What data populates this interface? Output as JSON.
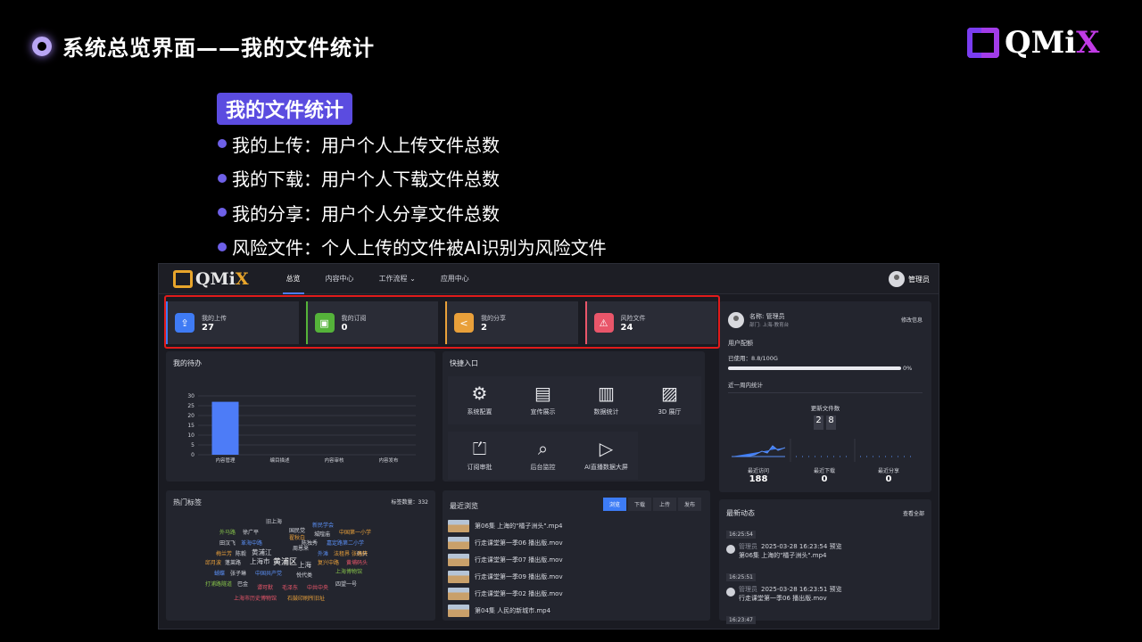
{
  "slide": {
    "title": "系统总览界面——我的文件统计",
    "logo": "QMi",
    "logo_x": "X",
    "section": "我的文件统计",
    "points": [
      "我的上传：用户个人上传文件总数",
      "我的下载：用户个人下载文件总数",
      "我的分享：用户个人分享文件总数",
      "风险文件：个人上传的文件被AI识别为风险文件"
    ]
  },
  "app": {
    "logo": "QMi",
    "logo_x": "X",
    "nav": [
      "总览",
      "内容中心",
      "工作流程 ⌄",
      "应用中心"
    ],
    "user": "管理员"
  },
  "stats": [
    {
      "label": "我的上传",
      "value": "27",
      "color": "#3f7bf4",
      "icon": "⇪"
    },
    {
      "label": "我的订阅",
      "value": "0",
      "color": "#55b33a",
      "icon": "▣"
    },
    {
      "label": "我的分享",
      "value": "2",
      "color": "#e9a03a",
      "icon": "<"
    },
    {
      "label": "风险文件",
      "value": "24",
      "color": "#e9566a",
      "icon": "⚠"
    }
  ],
  "todo": {
    "title": "我的待办",
    "yticks": [
      "30",
      "25",
      "20",
      "15",
      "10",
      "5",
      "0"
    ],
    "categories": [
      "内容管理",
      "编目描述",
      "内容审核",
      "内容发布"
    ]
  },
  "chart_data": {
    "type": "bar",
    "categories": [
      "内容管理",
      "编目描述",
      "内容审核",
      "内容发布"
    ],
    "values": [
      27,
      0,
      0,
      0
    ],
    "ylim": [
      0,
      30
    ]
  },
  "quick": {
    "title": "快捷入口",
    "items": [
      {
        "label": "系统配置",
        "icon": "⚙"
      },
      {
        "label": "宣传展示",
        "icon": "▤"
      },
      {
        "label": "数据统计",
        "icon": "▥"
      },
      {
        "label": "3D 展厅",
        "icon": "▨"
      },
      {
        "label": "订阅审批",
        "icon": "⏍"
      },
      {
        "label": "后台监控",
        "icon": "⌕"
      },
      {
        "label": "AI直播数据大屏",
        "icon": "▷"
      }
    ]
  },
  "profile": {
    "name": "名称: 管理员",
    "dept": "部门: 上海-教育台",
    "edit": "修改信息",
    "quota_title": "用户配额",
    "used": "已使用：8.8/100G",
    "percent": "0%",
    "week": "近一周内统计",
    "new_files": "更新文件数",
    "digits": [
      "2",
      "8"
    ],
    "minis": [
      {
        "label": "最近访问",
        "value": "188"
      },
      {
        "label": "最近下载",
        "value": "0"
      },
      {
        "label": "最近分享",
        "value": "0"
      }
    ]
  },
  "tags": {
    "title": "热门标签",
    "count": "标签数量：332",
    "words": [
      {
        "t": "旧上海",
        "c": "#d7d9e0"
      },
      {
        "t": "新民学会",
        "c": "#5a8ff5"
      },
      {
        "t": "国民党",
        "c": "#d7d9e0"
      },
      {
        "t": "外马路",
        "c": "#86c24a"
      },
      {
        "t": "徐广平",
        "c": "#d7d9e0"
      },
      {
        "t": "翟秋白",
        "c": "#e9a03a"
      },
      {
        "t": "城隍庙",
        "c": "#d7d9e0"
      },
      {
        "t": "中国第一小学",
        "c": "#e9a03a"
      },
      {
        "t": "田汉飞",
        "c": "#d7d9e0"
      },
      {
        "t": "革海中路",
        "c": "#5a8ff5"
      },
      {
        "t": "陈独秀",
        "c": "#d7d9e0"
      },
      {
        "t": "嘉定路第二小学",
        "c": "#5a8ff5"
      },
      {
        "t": "梅兰芳",
        "c": "#e9a03a"
      },
      {
        "t": "陈毅",
        "c": "#d7d9e0"
      },
      {
        "t": "黄浦江",
        "c": "#d7d9e0"
      },
      {
        "t": "周恩来",
        "c": "#d7d9e0"
      },
      {
        "t": "外滩",
        "c": "#5a8ff5"
      },
      {
        "t": "法租界",
        "c": "#e9a03a"
      },
      {
        "t": "码头",
        "c": "#d7d9e0"
      },
      {
        "t": "张逸轩",
        "c": "#e9a03a"
      },
      {
        "t": "邱月波",
        "c": "#e9a03a"
      },
      {
        "t": "蓬莱路",
        "c": "#d7d9e0"
      },
      {
        "t": "上海市",
        "c": "#d7d9e0"
      },
      {
        "t": "黄浦区",
        "c": "#ffffff"
      },
      {
        "t": "上海",
        "c": "#d7d9e0"
      },
      {
        "t": "复兴中路",
        "c": "#e9a03a"
      },
      {
        "t": "黄埔码头",
        "c": "#e9566a"
      },
      {
        "t": "蝴蝶",
        "c": "#5a8ff5"
      },
      {
        "t": "张子琳",
        "c": "#d7d9e0"
      },
      {
        "t": "中国共产党",
        "c": "#5a8ff5"
      },
      {
        "t": "悦代类",
        "c": "#d7d9e0"
      },
      {
        "t": "上海博物馆",
        "c": "#86c24a"
      },
      {
        "t": "打浦路隧道",
        "c": "#86c24a"
      },
      {
        "t": "巴金",
        "c": "#d7d9e0"
      },
      {
        "t": "谭可默",
        "c": "#e9566a"
      },
      {
        "t": "毛泽东",
        "c": "#e9566a"
      },
      {
        "t": "中共中央",
        "c": "#e9566a"
      },
      {
        "t": "四望一号",
        "c": "#d7d9e0"
      },
      {
        "t": "上海市历史博物馆",
        "c": "#e9566a"
      },
      {
        "t": "石鼓印刷所旧址",
        "c": "#e9a03a"
      }
    ]
  },
  "recent": {
    "title": "最近浏览",
    "tabs": [
      "浏览",
      "下载",
      "上传",
      "发布"
    ],
    "items": [
      "第06集 上海的\"橘子洲头\".mp4",
      "行走课堂第一季06 播出版.mov",
      "行走课堂第一季07 播出版.mov",
      "行走课堂第一季09 播出版.mov",
      "行走课堂第一季02 播出版.mov",
      "第04集 人民的新城市.mp4"
    ]
  },
  "feed": {
    "title": "最新动态",
    "all": "查看全部",
    "items": [
      {
        "time": "16:25:54",
        "user": "管理员",
        "action": "2025-03-28 16:23:54 预览",
        "file": "第06集 上海的\"橘子洲头\".mp4"
      },
      {
        "time": "16:25:51",
        "user": "管理员",
        "action": "2025-03-28 16:23:51 预览",
        "file": "行走课堂第一季06 播出版.mov"
      },
      {
        "time": "16:23:47",
        "user": "管理员",
        "action": "2025-03-28 16:23:47 预览",
        "file": "行走课堂第一季07 播出版.mov"
      }
    ]
  }
}
